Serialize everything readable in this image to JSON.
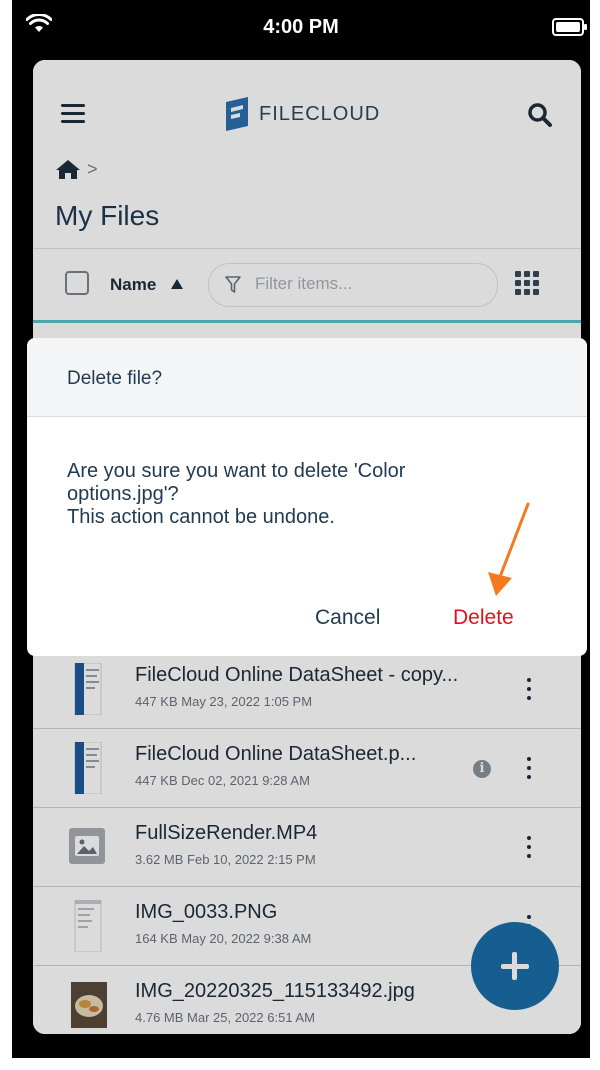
{
  "status_bar": {
    "time": "4:00 PM"
  },
  "header": {
    "logo_text": "FILECLOUD",
    "page_title": "My Files",
    "breadcrumb_separator": ">"
  },
  "toolbar": {
    "sort_label": "Name",
    "filter_placeholder": "Filter items..."
  },
  "files": [
    {
      "name": "FileCloud Online DataSheet - copy...",
      "meta": "447 KB May 23, 2022 1:05 PM"
    },
    {
      "name": "FileCloud Online DataSheet.p...",
      "meta": "447 KB Dec 02, 2021 9:28 AM"
    },
    {
      "name": "FullSizeRender.MP4",
      "meta": "3.62 MB Feb 10, 2022 2:15 PM"
    },
    {
      "name": "IMG_0033.PNG",
      "meta": "164 KB May 20, 2022 9:38 AM"
    },
    {
      "name": "IMG_20220325_115133492.jpg",
      "meta": "4.76 MB Mar 25, 2022 6:51 AM"
    }
  ],
  "dialog": {
    "title": "Delete file?",
    "message_line1": "Are you sure you want to delete 'Color",
    "message_line2": "options.jpg'?",
    "message_line3": "This action cannot be undone.",
    "cancel_label": "Cancel",
    "delete_label": "Delete"
  },
  "colors": {
    "accent": "#1b6ea8",
    "danger": "#e0121d",
    "annotation_arrow": "#f47a20"
  }
}
